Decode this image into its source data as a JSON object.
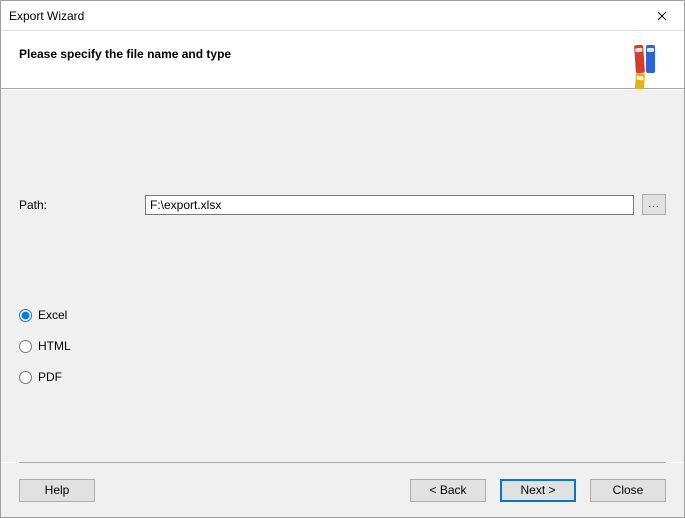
{
  "window": {
    "title": "Export Wizard"
  },
  "header": {
    "heading": "Please specify the file name and type"
  },
  "path": {
    "label": "Path:",
    "value": "F:\\export.xlsx",
    "browse_label": "..."
  },
  "formats": {
    "options": [
      {
        "label": "Excel",
        "selected": true
      },
      {
        "label": "HTML",
        "selected": false
      },
      {
        "label": "PDF",
        "selected": false
      }
    ]
  },
  "footer": {
    "help": "Help",
    "back": "< Back",
    "next": "Next >",
    "close": "Close"
  }
}
